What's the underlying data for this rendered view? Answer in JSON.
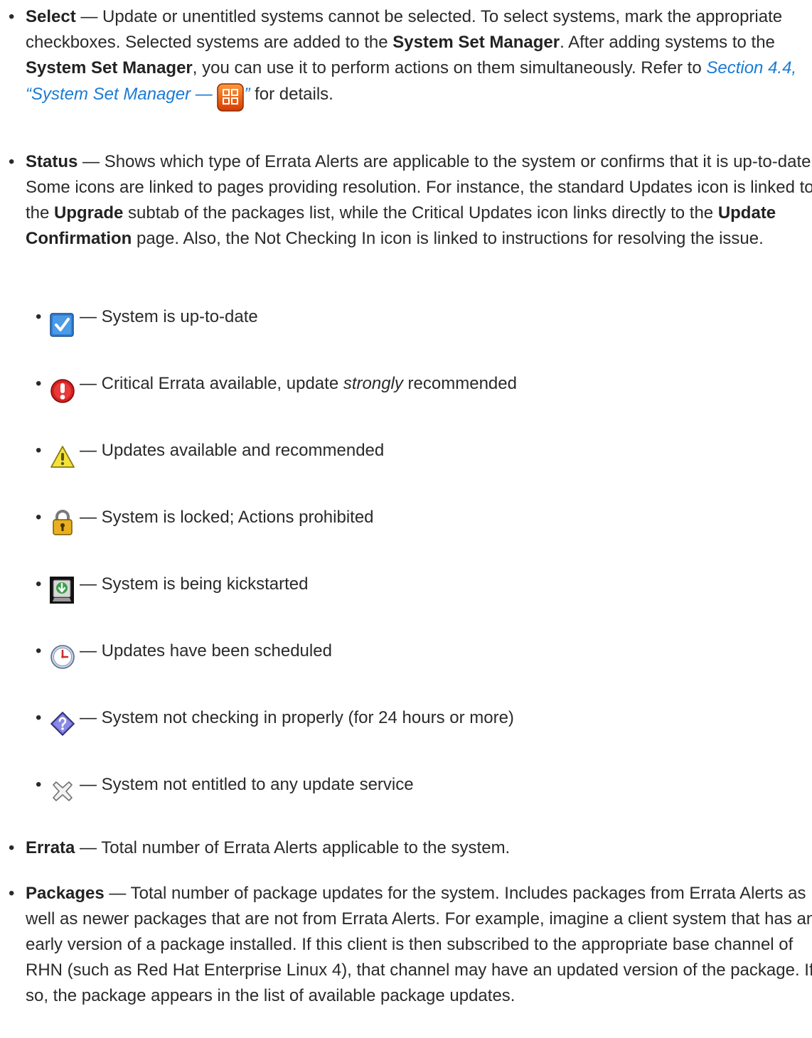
{
  "select": {
    "bullet": "•",
    "term": "Select",
    "text_a": " — Update or unentitled systems cannot be selected. To select systems, mark the appropriate checkboxes. Selected systems are added to the ",
    "ssm1": "System Set Manager",
    "text_b": ". After adding systems to the ",
    "ssm2": "System Set Manager",
    "text_c": ", you can use it to perform actions on them simultaneously. Refer to ",
    "link_text": "Section 4.4, “System Set Manager — ",
    "link_close": "”",
    "text_d": " for details.",
    "icon": "system-set-manager-icon"
  },
  "status": {
    "bullet": "•",
    "term": "Status",
    "text_a": " — Shows which type of Errata Alerts are applicable to the system or confirms that it is up-to-date. Some icons are linked to pages providing resolution. For instance, the standard Updates icon is linked to the ",
    "upgrade": "Upgrade",
    "text_b": " subtab of the packages list, while the Critical Updates icon links directly to the ",
    "update_conf": "Update Confirmation",
    "text_c": " page. Also, the Not Checking In icon is linked to instructions for resolving the issue."
  },
  "status_icons": [
    {
      "icon": "checkmark-icon",
      "text": "— System is up-to-date"
    },
    {
      "icon": "critical-alert-icon",
      "text_a": "— Critical Errata available, update ",
      "em": "strongly",
      "text_b": " recommended"
    },
    {
      "icon": "warning-icon",
      "text": "— Updates available and recommended"
    },
    {
      "icon": "lock-icon",
      "text": "— System is locked; Actions prohibited"
    },
    {
      "icon": "kickstart-icon",
      "text": "— System is being kickstarted"
    },
    {
      "icon": "clock-icon",
      "text": "— Updates have been scheduled"
    },
    {
      "icon": "question-icon",
      "text": "— System not checking in properly (for 24 hours or more)"
    },
    {
      "icon": "not-entitled-icon",
      "text": "— System not entitled to any update service"
    }
  ],
  "errata": {
    "bullet": "•",
    "term": "Errata",
    "text": " — Total number of Errata Alerts applicable to the system."
  },
  "packages": {
    "bullet": "•",
    "term": "Packages",
    "text": " — Total number of package updates for the system. Includes packages from Errata Alerts as well as newer packages that are not from Errata Alerts. For example, imagine a client system that has an early version of a package installed. If this client is then subscribed to the appropriate base channel of RHN (such as Red Hat Enterprise Linux 4), that channel may have an updated version of the package. If so, the package appears in the list of available package updates."
  },
  "colors": {
    "link": "#1a7ad4",
    "ssm_orange": "#e8560c",
    "critical_red": "#d42020",
    "check_blue": "#2f7fd6",
    "warning_yellow": "#f3e23a"
  }
}
